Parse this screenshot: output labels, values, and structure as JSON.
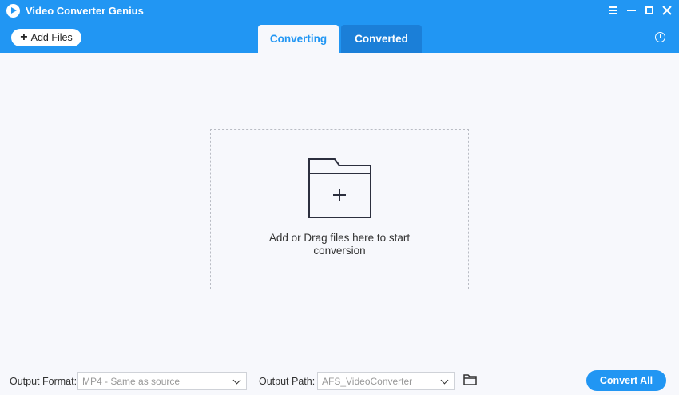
{
  "app": {
    "title": "Video Converter Genius",
    "logo_icon": "play-logo-icon"
  },
  "window_controls": {
    "icons": [
      "menu-icon",
      "minimize-icon",
      "maximize-icon",
      "close-icon"
    ]
  },
  "toolbar": {
    "add_files_label": "Add Files",
    "history_icon": "history-icon"
  },
  "tabs": [
    {
      "label": "Converting",
      "active": true
    },
    {
      "label": "Converted",
      "active": false
    }
  ],
  "dropzone": {
    "text": "Add or Drag files here to start conversion",
    "icon": "folder-plus-icon"
  },
  "footer": {
    "output_format_label": "Output Format:",
    "output_format_value": "MP4 - Same as source",
    "output_path_label": "Output Path:",
    "output_path_value": "AFS_VideoConverter",
    "folder_icon": "folder-open-icon",
    "convert_all_label": "Convert All"
  },
  "colors": {
    "accent": "#2196f3",
    "tab_inactive": "#1b7fd8",
    "background": "#f7f8fc"
  }
}
